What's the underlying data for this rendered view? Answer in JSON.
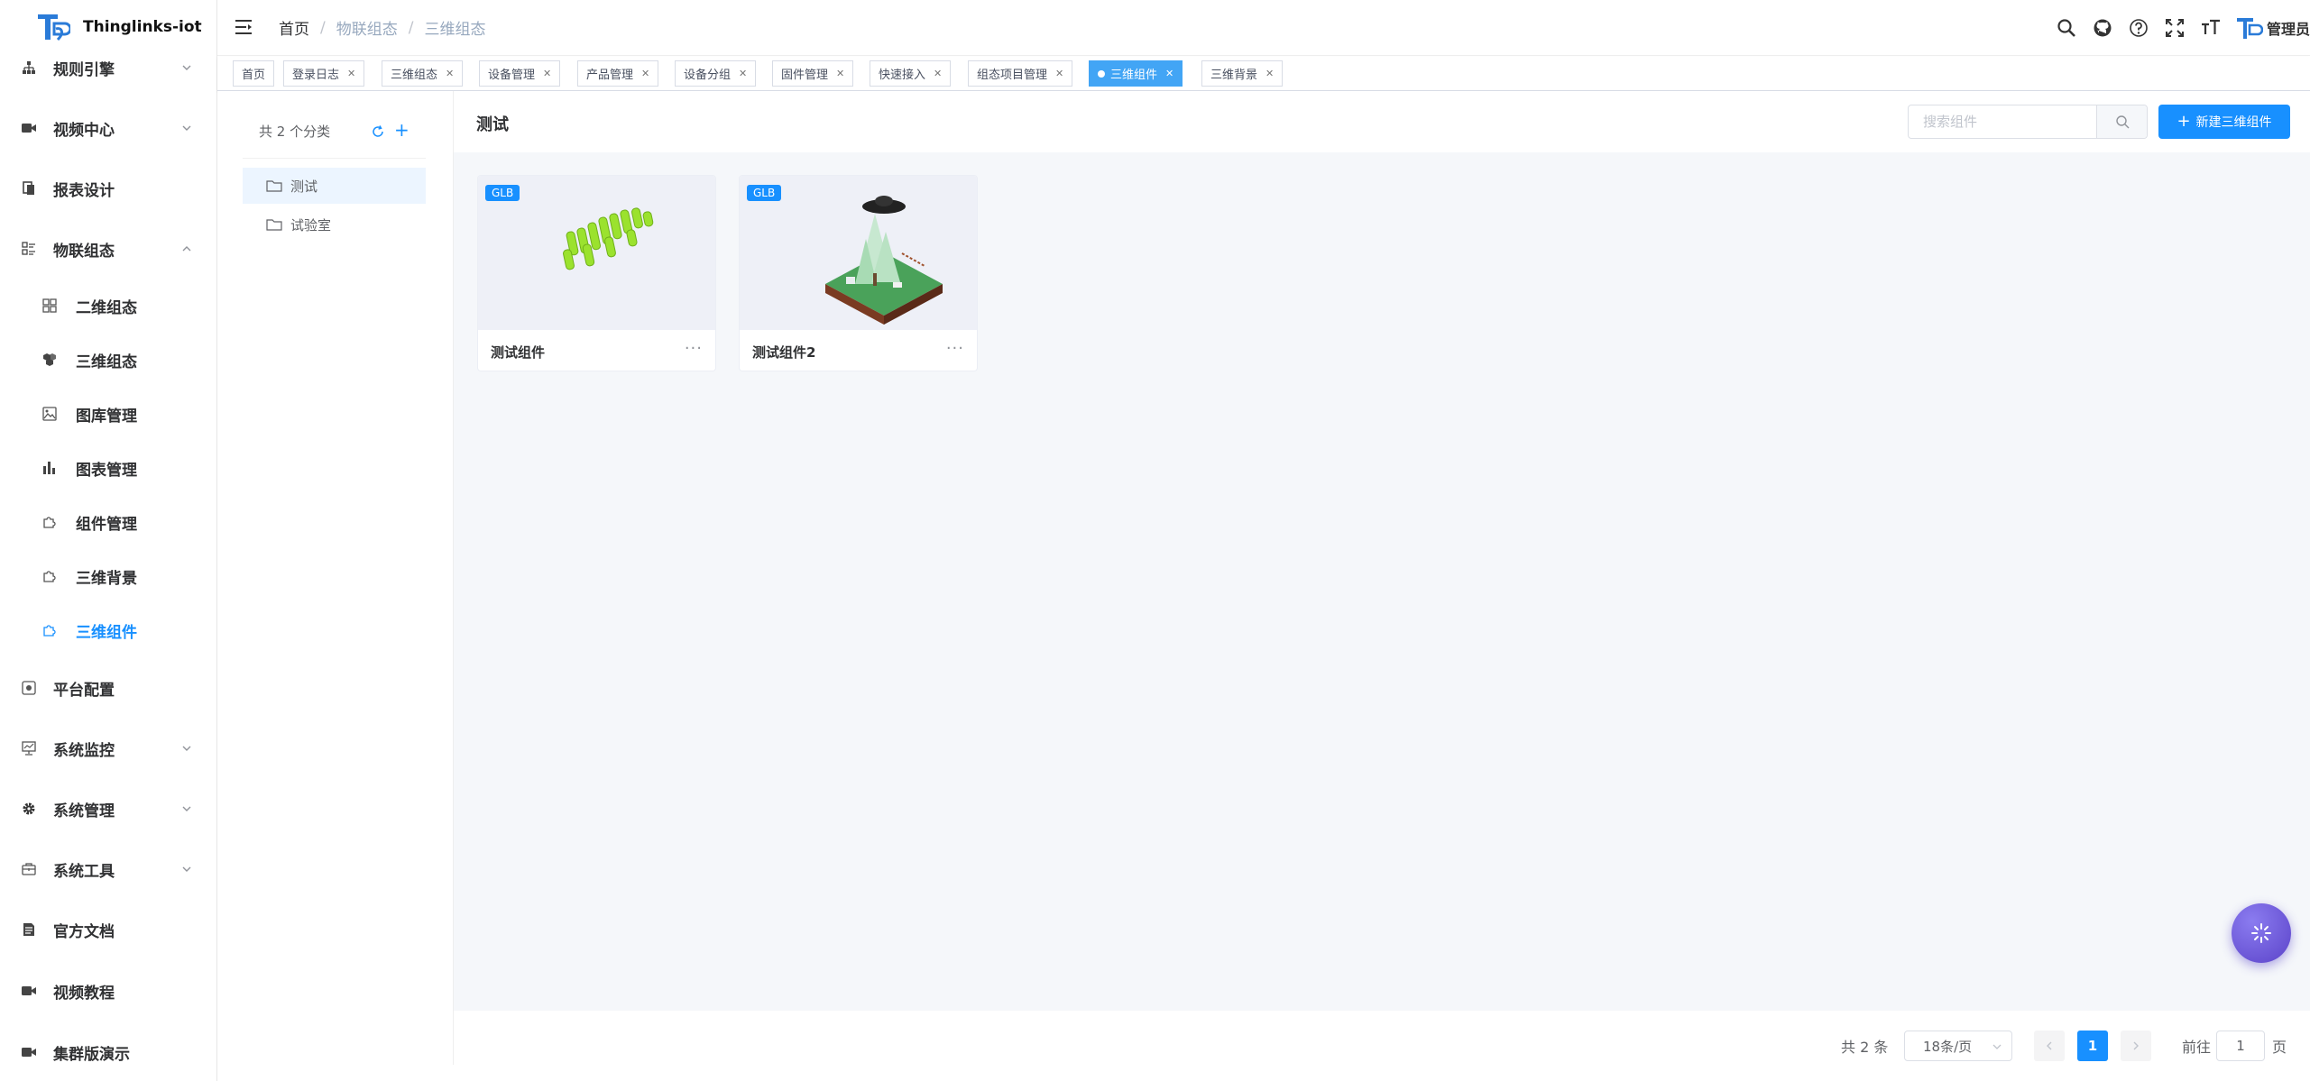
{
  "app": {
    "name": "Thinglinks-iot"
  },
  "sidebar": {
    "items": [
      {
        "label": "规则引擎",
        "icon": "sitemap-icon",
        "expandable": true
      },
      {
        "label": "视频中心",
        "icon": "video-icon",
        "expandable": true
      },
      {
        "label": "报表设计",
        "icon": "report-icon",
        "expandable": false
      },
      {
        "label": "物联组态",
        "icon": "list-icon",
        "expandable": true,
        "expanded": true
      },
      {
        "label": "二维组态",
        "icon": "grid-icon",
        "sub": true
      },
      {
        "label": "三维组态",
        "icon": "cubes-icon",
        "sub": true
      },
      {
        "label": "图库管理",
        "icon": "image-icon",
        "sub": true
      },
      {
        "label": "图表管理",
        "icon": "bar-chart-icon",
        "sub": true
      },
      {
        "label": "组件管理",
        "icon": "puzzle-icon",
        "sub": true
      },
      {
        "label": "三维背景",
        "icon": "puzzle-outline-icon",
        "sub": true
      },
      {
        "label": "三维组件",
        "icon": "puzzle-outline-icon",
        "sub": true,
        "active": true
      },
      {
        "label": "平台配置",
        "icon": "config-icon",
        "expandable": false
      },
      {
        "label": "系统监控",
        "icon": "monitor-icon",
        "expandable": true
      },
      {
        "label": "系统管理",
        "icon": "gear-icon",
        "expandable": true
      },
      {
        "label": "系统工具",
        "icon": "toolbox-icon",
        "expandable": true
      },
      {
        "label": "官方文档",
        "icon": "document-icon",
        "expandable": false
      },
      {
        "label": "视频教程",
        "icon": "video-icon",
        "expandable": false
      },
      {
        "label": "集群版演示",
        "icon": "video-icon",
        "expandable": false
      }
    ]
  },
  "header": {
    "breadcrumb": [
      "首页",
      "物联组态",
      "三维组态"
    ],
    "user": "管理员"
  },
  "tags": [
    {
      "label": "首页",
      "closable": false
    },
    {
      "label": "登录日志",
      "closable": true
    },
    {
      "label": "三维组态",
      "closable": true
    },
    {
      "label": "设备管理",
      "closable": true
    },
    {
      "label": "产品管理",
      "closable": true
    },
    {
      "label": "设备分组",
      "closable": true
    },
    {
      "label": "固件管理",
      "closable": true
    },
    {
      "label": "快速接入",
      "closable": true
    },
    {
      "label": "组态项目管理",
      "closable": true
    },
    {
      "label": "三维组件",
      "closable": true,
      "active": true
    },
    {
      "label": "三维背景",
      "closable": true
    }
  ],
  "categories": {
    "count_label": "共 2 个分类",
    "items": [
      {
        "label": "测试",
        "selected": true
      },
      {
        "label": "试验室",
        "selected": false
      }
    ]
  },
  "main": {
    "title": "测试",
    "search_placeholder": "搜索组件",
    "new_button": "新建三维组件",
    "cards": [
      {
        "name": "测试组件",
        "badge": "GLB"
      },
      {
        "name": "测试组件2",
        "badge": "GLB"
      }
    ]
  },
  "pagination": {
    "total": "共 2 条",
    "page_size": "18条/页",
    "current_page": "1",
    "goto_label": "前往",
    "goto_value": "1",
    "page_unit": "页"
  },
  "colors": {
    "accent": "#1890ff",
    "active_tag": "#42a5f5",
    "fab": "#6a55d6"
  }
}
